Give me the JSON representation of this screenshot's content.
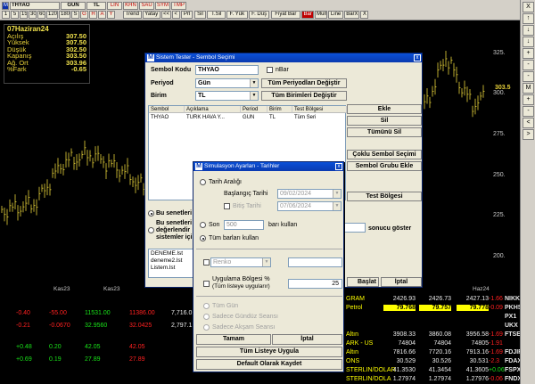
{
  "toolbar": {
    "symbol": "THYAO",
    "period": "GUN",
    "unit": "TL",
    "buttons1": [
      "LIN",
      "KHN",
      "SAU",
      "SYM",
      "TMP"
    ],
    "periods": [
      "1",
      "5",
      "15",
      "30",
      "60",
      "120",
      "180",
      "S"
    ],
    "buttons2": [
      "G",
      "H",
      "A",
      "Y"
    ],
    "tools": [
      "Trend",
      "Yatay",
      "<<",
      "<",
      "Prl",
      "Sil",
      "T.Sil",
      "F. Yük",
      "F. Düş",
      "Fiyat Bar",
      "Bar",
      "Mum",
      "Line",
      "BarX",
      "X"
    ]
  },
  "info": {
    "date": "07Haziran24",
    "rows": [
      {
        "label": "Açılış",
        "value": "307.50"
      },
      {
        "label": "Yüksek",
        "value": "307.50"
      },
      {
        "label": "Düşük",
        "value": "302.50"
      },
      {
        "label": "Kapanış",
        "value": "303.50"
      },
      {
        "label": "Ağ. Ort",
        "value": "303.96"
      },
      {
        "label": "%Fark",
        "value": "-0.65"
      }
    ]
  },
  "yaxis": {
    "ticks": [
      "325.",
      "300.",
      "275.",
      "250.",
      "225.",
      "200."
    ],
    "last_price": "303.5"
  },
  "xaxis": {
    "labels": [
      "Kas23",
      "Kas23",
      "Haz24"
    ]
  },
  "rightbar": {
    "buttons": [
      "X",
      "↑",
      "↓",
      "↓",
      "+",
      "-",
      "-",
      "M",
      "+",
      "-",
      "<",
      ">"
    ]
  },
  "bottom": {
    "left_rows": [
      [
        "-0.40",
        "-55.00",
        "11531.00",
        "11386.00",
        "7,716.0"
      ],
      [
        "-0.21",
        "-0.0670",
        "32.9560",
        "32.0425",
        "2,797.1"
      ],
      [
        "+0.48",
        "0.20",
        "42.05",
        "42.05",
        ""
      ],
      [
        "+0.69",
        "0.19",
        "27.89",
        "27.89",
        ""
      ]
    ],
    "right_rows": [
      {
        "name": "GRAM",
        "v1": "2426.93",
        "v2": "2426.73",
        "v3": "2427.13",
        "pct": "-1.66",
        "code": "NIKK"
      },
      {
        "name": "Petrol",
        "v1": "79.768",
        "v2": "79.757",
        "v3": "79.778",
        "pct": "-0.09",
        "code": "PKHS"
      },
      {
        "name": "",
        "v1": "",
        "v2": "",
        "v3": "",
        "pct": "",
        "code": "PX1"
      },
      {
        "name": "",
        "v1": "",
        "v2": "",
        "v3": "",
        "pct": "",
        "code": "UKX"
      },
      {
        "name": "Altın",
        "v1": "3908.33",
        "v2": "3860.08",
        "v3": "3956.58",
        "pct": "-1.69",
        "code": "FTSET"
      },
      {
        "name": "ARK - US",
        "v1": "74804",
        "v2": "74804",
        "v3": "74805",
        "pct": "-1.91",
        "code": ""
      },
      {
        "name": "Altın",
        "v1": "7816.66",
        "v2": "7720.16",
        "v3": "7913.16",
        "pct": "-1.69",
        "code": "FDJIR"
      },
      {
        "name": "ONS",
        "v1": "30.529",
        "v2": "30.526",
        "v3": "30.531",
        "pct": "-2.3",
        "code": "FDAXI"
      },
      {
        "name": "STERLIN/DOLAR",
        "v1": "41.3530",
        "v2": "41.3454",
        "v3": "41.3605",
        "pct": "+0.06",
        "code": "FSPX"
      },
      {
        "name": "STERLIN/DOLA",
        "v1": "1.27974",
        "v2": "1.27974",
        "v3": "1.27976",
        "pct": "-0.06",
        "code": "FNDX"
      }
    ]
  },
  "colors": {
    "chart_bars": "#e8d23a",
    "title_bar": "#0a3ab0",
    "dialog_bg": "#ece9d8",
    "highlight": "#ffff00"
  },
  "dlg1": {
    "title": "Sistem Tester - Sembol Seçimi",
    "kod_label": "Sembol Kodu",
    "kod_value": "THYAO",
    "nbar_label": "nBar",
    "periyod_label": "Periyod",
    "periyod_value": "Gün",
    "periyod_btn": "Tüm Periyodları Değiştir",
    "birim_label": "Birim",
    "birim_value": "TL",
    "birim_btn": "Tüm Birimleri Değiştir",
    "columns": [
      "Sembol",
      "Açıklama",
      "Period",
      "Birim",
      "Test Bölgesi"
    ],
    "row": [
      "THYAO",
      "TURK HAVA Y...",
      "GUN",
      "TL",
      "Tüm Seri"
    ],
    "ekle": "Ekle",
    "sil": "Sil",
    "tumunu_sil": "Tümünü Sil",
    "coklu": "Çoklu Sembol Seçimi",
    "grubu": "Sembol Grubu Ekle",
    "test_bolgesi": "Test Bölgesi",
    "opt1": "Bu senetleri",
    "opt2a": "Bu senetleri",
    "opt2b": "değerlendir",
    "opt2c": "sistemler içi",
    "sonucu": "sonucu göster",
    "files": [
      "DENEME.lst",
      "deneme2.lst",
      "Listem.lst"
    ],
    "baslat": "Başlat",
    "iptal": "İptal"
  },
  "dlg2": {
    "title": "Simulasyon Ayarları - Tarihler",
    "tarih_araligi": "Tarih Aralığı",
    "baslangic": "Başlangıç Tarihi",
    "baslangic_val": "09/02/2024",
    "bitis": "Bitiş Tarihi",
    "bitis_val": "07/06/2024",
    "son": "Son",
    "son_val": "500",
    "bari_kullan": "barı kullan",
    "tum_barlar": "Tüm barları kullan",
    "renko": "Renko",
    "uygulama": "Uygulama Bölgesi %",
    "uygulama2": "(Tüm listeye uygularır)",
    "uygulama_val": "25",
    "tum_gun": "Tüm Gün",
    "gunduz": "Sadece Gündüz Seansı",
    "aksam": "Sadece Akşam Seansı",
    "tamam": "Tamam",
    "iptal": "İptal",
    "tum_liste": "Tüm Listeye Uygula",
    "default": "Default Olarak Kaydet"
  }
}
